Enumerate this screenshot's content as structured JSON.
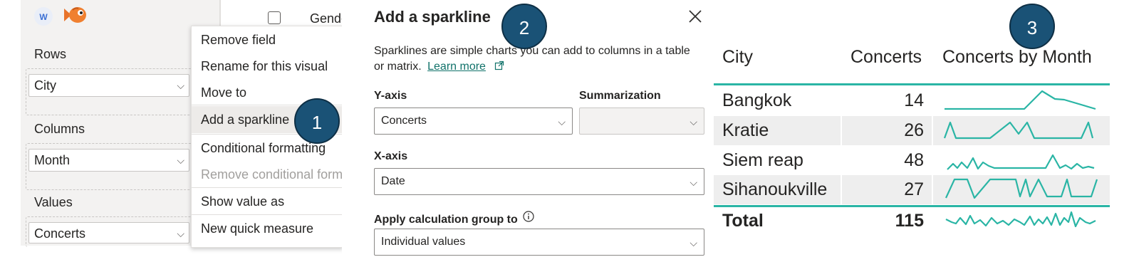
{
  "fields_pane": {
    "rows_label": "Rows",
    "rows_field": "City",
    "columns_label": "Columns",
    "columns_field": "Month",
    "values_label": "Values",
    "values_field": "Concerts",
    "top_right_text": "Gende",
    "icons": [
      "w-logo-icon",
      "fish-icon",
      "checkbox-icon",
      "chevron-down-icon"
    ]
  },
  "context_menu": {
    "items": [
      {
        "label": "Remove field"
      },
      {
        "label": "Rename for this visual"
      },
      {
        "label": "Move to"
      },
      {
        "label": "Add a sparkline"
      },
      {
        "label": "Conditional formatting"
      },
      {
        "label": "Remove conditional form"
      },
      {
        "label": "Show value as"
      },
      {
        "label": "New quick measure"
      }
    ]
  },
  "steps": [
    "1",
    "2",
    "3"
  ],
  "dialog": {
    "title": "Add a sparkline",
    "description": "Sparklines are simple charts you can add to columns in a table or matrix.",
    "learn_more": "Learn more",
    "yaxis_label": "Y-axis",
    "yaxis_value": "Concerts",
    "summarization_label": "Summarization",
    "summarization_value": "",
    "xaxis_label": "X-axis",
    "xaxis_value": "Date",
    "calc_group_label": "Apply calculation group to",
    "calc_group_value": "Individual values"
  },
  "table": {
    "headers": {
      "city": "City",
      "concerts": "Concerts",
      "by_month": "Concerts by Month"
    },
    "rows": [
      {
        "city": "Bangkok",
        "concerts": "14"
      },
      {
        "city": "Kratie",
        "concerts": "26"
      },
      {
        "city": "Siem reap",
        "concerts": "48"
      },
      {
        "city": "Sihanoukville",
        "concerts": "27"
      }
    ],
    "total": {
      "label": "Total",
      "concerts": "115"
    },
    "accent": "#2ab5a5"
  }
}
